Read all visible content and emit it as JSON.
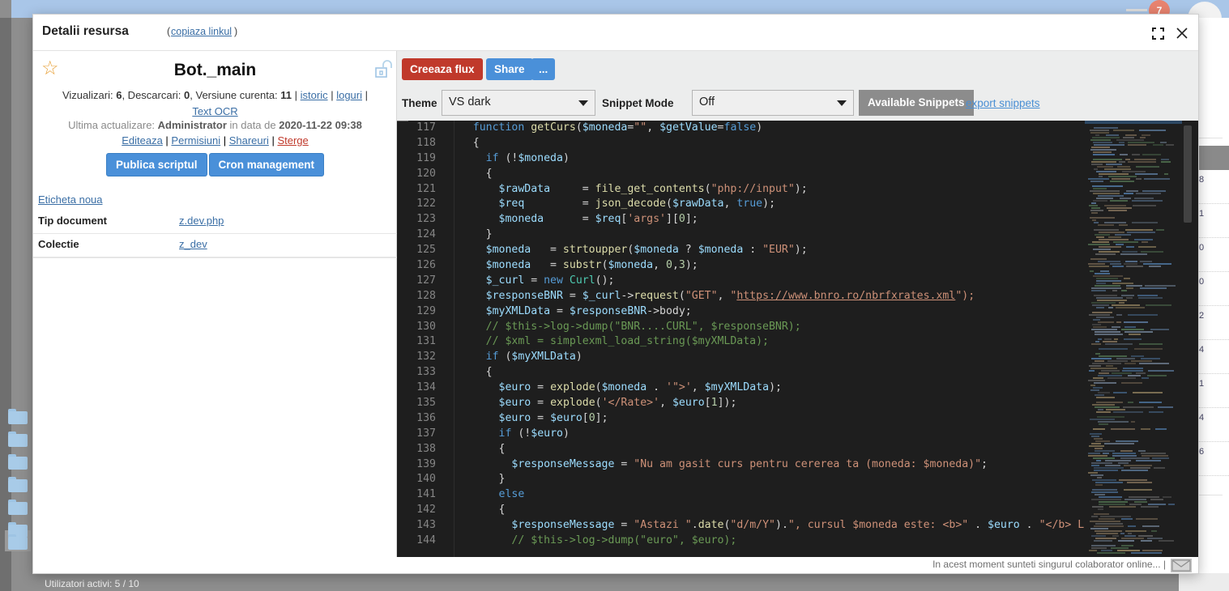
{
  "background": {
    "sidebar_label": "Mail",
    "status_text": "Utilizatori activi: 5 / 10",
    "notification_badge": "7",
    "table_numbers": [
      "8",
      "1",
      "0",
      "0",
      "2",
      "4",
      "1",
      "4",
      "6"
    ]
  },
  "modal": {
    "title": "Detalii resursa",
    "copy_link_label": "copiaza linkul",
    "paren_open": "(",
    "paren_close": ")",
    "expand_icon": "expand-icon",
    "close_icon": "close-icon",
    "footer_text": "In acest moment sunteti singurul colaborator online... |",
    "mail_icon": "mail-icon"
  },
  "detail": {
    "star_icon": "star-icon",
    "lock_icon": "unlocked-padlock-icon",
    "resource_name": "Bot._main",
    "stats_prefix": "Vizualizari: ",
    "views": "6",
    "downloads_label": ", Descarcari: ",
    "downloads": "0",
    "version_label": ", Versiune curenta: ",
    "version": "11",
    "sep": " | ",
    "link_istoric": "istoric",
    "link_loguri": "loguri",
    "link_ocr": "Text OCR",
    "updated_prefix": "Ultima actualizare: ",
    "updated_by": "Administrator",
    "updated_mid": " in data de ",
    "updated_date": "2020-11-22 09:38",
    "actions": [
      {
        "label": "Editeaza",
        "danger": false
      },
      {
        "label": "Permisiuni",
        "danger": false
      },
      {
        "label": "Shareuri",
        "danger": false
      },
      {
        "label": "Sterge",
        "danger": true
      }
    ],
    "action_sep": " | ",
    "btn_publish": "Publica scriptul",
    "btn_cron": "Cron management",
    "tag_link": "Eticheta noua",
    "meta_rows": [
      {
        "key": "Tip document",
        "value": "z.dev.php"
      },
      {
        "key": "Colectie",
        "value": "z_dev"
      }
    ]
  },
  "editor": {
    "btn_create_flux": "Creeaza flux",
    "btn_share": "Share",
    "btn_more": "...",
    "label_theme": "Theme",
    "theme_value": "VS dark",
    "label_snippet_mode": "Snippet Mode",
    "snippet_value": "Off",
    "btn_available_snippets": "Available Snippets",
    "link_export_snippets": "export snippets",
    "colors": {
      "background": "#1e1e1e",
      "keyword": "#569cd6",
      "string": "#ce9178",
      "comment": "#6a9955",
      "variable": "#9cdcfe",
      "function": "#dcdcaa",
      "number": "#b5cea8",
      "line_number": "#858585"
    },
    "first_line": 117,
    "lines": [
      {
        "n": "117",
        "tokens": [
          {
            "t": "    ",
            "c": "pn"
          },
          {
            "t": "function ",
            "c": "kw"
          },
          {
            "t": "getCurs",
            "c": "fn"
          },
          {
            "t": "(",
            "c": "pn"
          },
          {
            "t": "$moneda",
            "c": "var"
          },
          {
            "t": "=",
            "c": "pn"
          },
          {
            "t": "\"\"",
            "c": "str"
          },
          {
            "t": ", ",
            "c": "pn"
          },
          {
            "t": "$getValue",
            "c": "var"
          },
          {
            "t": "=",
            "c": "pn"
          },
          {
            "t": "false",
            "c": "kw"
          },
          {
            "t": ")",
            "c": "pn"
          }
        ]
      },
      {
        "n": "118",
        "tokens": [
          {
            "t": "    {",
            "c": "pn"
          }
        ]
      },
      {
        "n": "119",
        "tokens": [
          {
            "t": "      ",
            "c": "pn"
          },
          {
            "t": "if",
            "c": "kw"
          },
          {
            "t": " (!",
            "c": "pn"
          },
          {
            "t": "$moneda",
            "c": "var"
          },
          {
            "t": ")",
            "c": "pn"
          }
        ]
      },
      {
        "n": "120",
        "tokens": [
          {
            "t": "      {",
            "c": "pn"
          }
        ]
      },
      {
        "n": "121",
        "tokens": [
          {
            "t": "        ",
            "c": "pn"
          },
          {
            "t": "$rawData",
            "c": "var"
          },
          {
            "t": "     = ",
            "c": "pn"
          },
          {
            "t": "file_get_contents",
            "c": "fn"
          },
          {
            "t": "(",
            "c": "pn"
          },
          {
            "t": "\"php://input\"",
            "c": "str"
          },
          {
            "t": ");",
            "c": "pn"
          }
        ]
      },
      {
        "n": "122",
        "tokens": [
          {
            "t": "        ",
            "c": "pn"
          },
          {
            "t": "$req",
            "c": "var"
          },
          {
            "t": "         = ",
            "c": "pn"
          },
          {
            "t": "json_decode",
            "c": "fn"
          },
          {
            "t": "(",
            "c": "pn"
          },
          {
            "t": "$rawData",
            "c": "var"
          },
          {
            "t": ", ",
            "c": "pn"
          },
          {
            "t": "true",
            "c": "kw"
          },
          {
            "t": ");",
            "c": "pn"
          }
        ]
      },
      {
        "n": "123",
        "tokens": [
          {
            "t": "        ",
            "c": "pn"
          },
          {
            "t": "$moneda",
            "c": "var"
          },
          {
            "t": "      = ",
            "c": "pn"
          },
          {
            "t": "$req",
            "c": "var"
          },
          {
            "t": "[",
            "c": "pn"
          },
          {
            "t": "'args'",
            "c": "str"
          },
          {
            "t": "][",
            "c": "pn"
          },
          {
            "t": "0",
            "c": "num"
          },
          {
            "t": "];",
            "c": "pn"
          }
        ]
      },
      {
        "n": "124",
        "tokens": [
          {
            "t": "      }",
            "c": "pn"
          }
        ]
      },
      {
        "n": "125",
        "tokens": [
          {
            "t": "      ",
            "c": "pn"
          },
          {
            "t": "$moneda",
            "c": "var"
          },
          {
            "t": "   = ",
            "c": "pn"
          },
          {
            "t": "strtoupper",
            "c": "fn"
          },
          {
            "t": "(",
            "c": "pn"
          },
          {
            "t": "$moneda",
            "c": "var"
          },
          {
            "t": " ? ",
            "c": "pn"
          },
          {
            "t": "$moneda",
            "c": "var"
          },
          {
            "t": " : ",
            "c": "pn"
          },
          {
            "t": "\"EUR\"",
            "c": "str"
          },
          {
            "t": ");",
            "c": "pn"
          }
        ]
      },
      {
        "n": "126",
        "tokens": [
          {
            "t": "      ",
            "c": "pn"
          },
          {
            "t": "$moneda",
            "c": "var"
          },
          {
            "t": "   = ",
            "c": "pn"
          },
          {
            "t": "substr",
            "c": "fn"
          },
          {
            "t": "(",
            "c": "pn"
          },
          {
            "t": "$moneda",
            "c": "var"
          },
          {
            "t": ", ",
            "c": "pn"
          },
          {
            "t": "0",
            "c": "num"
          },
          {
            "t": ",",
            "c": "pn"
          },
          {
            "t": "3",
            "c": "num"
          },
          {
            "t": ");",
            "c": "pn"
          }
        ]
      },
      {
        "n": "127",
        "tokens": [
          {
            "t": "      ",
            "c": "pn"
          },
          {
            "t": "$_curl",
            "c": "var"
          },
          {
            "t": " = ",
            "c": "pn"
          },
          {
            "t": "new",
            "c": "kw"
          },
          {
            "t": " ",
            "c": "pn"
          },
          {
            "t": "Curl",
            "c": "type"
          },
          {
            "t": "();",
            "c": "pn"
          }
        ]
      },
      {
        "n": "128",
        "tokens": [
          {
            "t": "      ",
            "c": "pn"
          },
          {
            "t": "$responseBNR",
            "c": "var"
          },
          {
            "t": " = ",
            "c": "pn"
          },
          {
            "t": "$_curl",
            "c": "var"
          },
          {
            "t": "->",
            "c": "pn"
          },
          {
            "t": "request",
            "c": "fn"
          },
          {
            "t": "(",
            "c": "pn"
          },
          {
            "t": "\"GET\"",
            "c": "str"
          },
          {
            "t": ", ",
            "c": "pn"
          },
          {
            "t": "\"",
            "c": "str"
          },
          {
            "t": "https://www.bnro.ro/nbrfxrates.xml",
            "c": "url"
          },
          {
            "t": "\");",
            "c": "str"
          }
        ]
      },
      {
        "n": "129",
        "tokens": [
          {
            "t": "      ",
            "c": "pn"
          },
          {
            "t": "$myXMLData",
            "c": "var"
          },
          {
            "t": " = ",
            "c": "pn"
          },
          {
            "t": "$responseBNR",
            "c": "var"
          },
          {
            "t": "->body;",
            "c": "pn"
          }
        ]
      },
      {
        "n": "130",
        "tokens": [
          {
            "t": "      // $this->log->dump(\"BNR....CURL\", $responseBNR);",
            "c": "cmt"
          }
        ]
      },
      {
        "n": "131",
        "tokens": [
          {
            "t": "      // $xml = simplexml_load_string($myXMLData);",
            "c": "cmt"
          }
        ]
      },
      {
        "n": "132",
        "tokens": [
          {
            "t": "      ",
            "c": "pn"
          },
          {
            "t": "if",
            "c": "kw"
          },
          {
            "t": " (",
            "c": "pn"
          },
          {
            "t": "$myXMLData",
            "c": "var"
          },
          {
            "t": ")",
            "c": "pn"
          }
        ]
      },
      {
        "n": "133",
        "tokens": [
          {
            "t": "      {",
            "c": "pn"
          }
        ]
      },
      {
        "n": "134",
        "tokens": [
          {
            "t": "        ",
            "c": "pn"
          },
          {
            "t": "$euro",
            "c": "var"
          },
          {
            "t": " = ",
            "c": "pn"
          },
          {
            "t": "explode",
            "c": "fn"
          },
          {
            "t": "(",
            "c": "pn"
          },
          {
            "t": "$moneda",
            "c": "var"
          },
          {
            "t": " . ",
            "c": "pn"
          },
          {
            "t": "'\">'",
            "c": "str"
          },
          {
            "t": ", ",
            "c": "pn"
          },
          {
            "t": "$myXMLData",
            "c": "var"
          },
          {
            "t": ");",
            "c": "pn"
          }
        ]
      },
      {
        "n": "135",
        "tokens": [
          {
            "t": "        ",
            "c": "pn"
          },
          {
            "t": "$euro",
            "c": "var"
          },
          {
            "t": " = ",
            "c": "pn"
          },
          {
            "t": "explode",
            "c": "fn"
          },
          {
            "t": "(",
            "c": "pn"
          },
          {
            "t": "'</Rate>'",
            "c": "str"
          },
          {
            "t": ", ",
            "c": "pn"
          },
          {
            "t": "$euro",
            "c": "var"
          },
          {
            "t": "[",
            "c": "pn"
          },
          {
            "t": "1",
            "c": "num"
          },
          {
            "t": "]);",
            "c": "pn"
          }
        ]
      },
      {
        "n": "136",
        "tokens": [
          {
            "t": "        ",
            "c": "pn"
          },
          {
            "t": "$euro",
            "c": "var"
          },
          {
            "t": " = ",
            "c": "pn"
          },
          {
            "t": "$euro",
            "c": "var"
          },
          {
            "t": "[",
            "c": "pn"
          },
          {
            "t": "0",
            "c": "num"
          },
          {
            "t": "];",
            "c": "pn"
          }
        ]
      },
      {
        "n": "137",
        "tokens": [
          {
            "t": "        ",
            "c": "pn"
          },
          {
            "t": "if",
            "c": "kw"
          },
          {
            "t": " (!",
            "c": "pn"
          },
          {
            "t": "$euro",
            "c": "var"
          },
          {
            "t": ")",
            "c": "pn"
          }
        ]
      },
      {
        "n": "138",
        "tokens": [
          {
            "t": "        {",
            "c": "pn"
          }
        ]
      },
      {
        "n": "139",
        "tokens": [
          {
            "t": "          ",
            "c": "pn"
          },
          {
            "t": "$responseMessage",
            "c": "var"
          },
          {
            "t": " = ",
            "c": "pn"
          },
          {
            "t": "\"Nu am gasit curs pentru cererea ta (moneda: $moneda)\"",
            "c": "str"
          },
          {
            "t": ";",
            "c": "pn"
          }
        ]
      },
      {
        "n": "140",
        "tokens": [
          {
            "t": "        }",
            "c": "pn"
          }
        ]
      },
      {
        "n": "141",
        "tokens": [
          {
            "t": "        ",
            "c": "pn"
          },
          {
            "t": "else",
            "c": "kw"
          }
        ]
      },
      {
        "n": "142",
        "tokens": [
          {
            "t": "        {",
            "c": "pn"
          }
        ]
      },
      {
        "n": "143",
        "tokens": [
          {
            "t": "          ",
            "c": "pn"
          },
          {
            "t": "$responseMessage",
            "c": "var"
          },
          {
            "t": " = ",
            "c": "pn"
          },
          {
            "t": "\"Astazi \"",
            "c": "str"
          },
          {
            "t": ".",
            "c": "pn"
          },
          {
            "t": "date",
            "c": "fn"
          },
          {
            "t": "(",
            "c": "pn"
          },
          {
            "t": "\"d/m/Y\"",
            "c": "str"
          },
          {
            "t": ").",
            "c": "pn"
          },
          {
            "t": "\", cursul $moneda este: <b>\"",
            "c": "str"
          },
          {
            "t": " . ",
            "c": "pn"
          },
          {
            "t": "$euro",
            "c": "var"
          },
          {
            "t": " . ",
            "c": "pn"
          },
          {
            "t": "\"</b> LEI\"",
            "c": "str"
          },
          {
            "t": ";",
            "c": "pn"
          }
        ]
      },
      {
        "n": "144",
        "tokens": [
          {
            "t": "          // $this->log->dump(\"euro\", $euro);",
            "c": "cmt"
          }
        ]
      }
    ]
  }
}
